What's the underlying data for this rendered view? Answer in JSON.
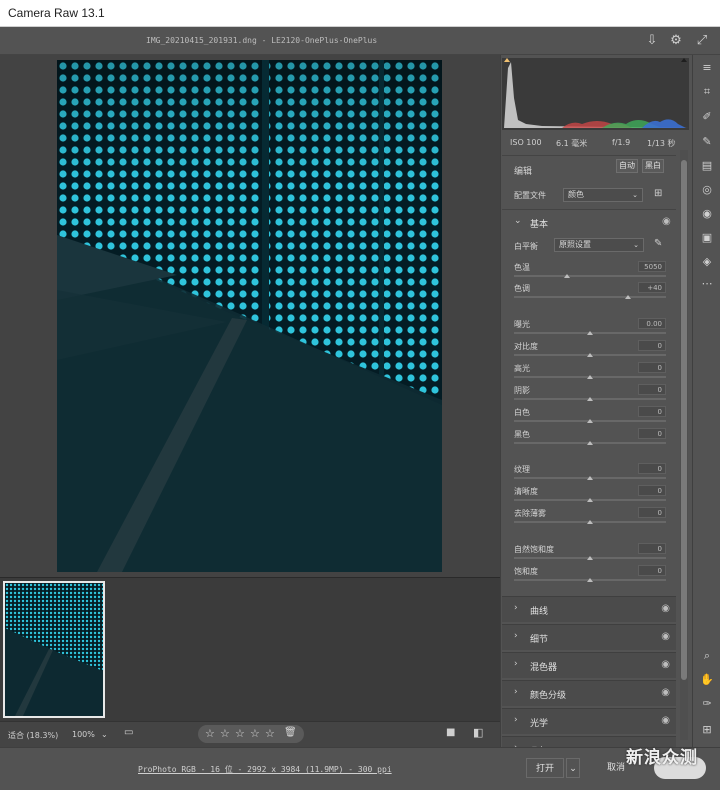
{
  "window": {
    "title": "Camera Raw 13.1"
  },
  "file": {
    "name": "IMG_20210415_201931.dng -  LE2120-OnePlus-OnePlus"
  },
  "exif": {
    "iso": "ISO 100",
    "focal": "6.1 毫米",
    "aperture": "f/1.9",
    "shutter": "1/13 秒"
  },
  "edit": {
    "title": "编辑",
    "auto_label": "自动",
    "bw_label": "黑白"
  },
  "profile": {
    "label": "配置文件",
    "value": "颜色"
  },
  "basic": {
    "title": "基本",
    "white_balance": {
      "label": "白平衡",
      "value": "原照设置"
    },
    "temperature": {
      "label": "色温",
      "value": "5050"
    },
    "tint": {
      "label": "色调",
      "value": "+40"
    },
    "exposure": {
      "label": "曝光",
      "value": "0.00"
    },
    "contrast": {
      "label": "对比度",
      "value": "0"
    },
    "highlights": {
      "label": "高光",
      "value": "0"
    },
    "shadows": {
      "label": "阴影",
      "value": "0"
    },
    "whites": {
      "label": "白色",
      "value": "0"
    },
    "blacks": {
      "label": "黑色",
      "value": "0"
    },
    "texture": {
      "label": "纹理",
      "value": "0"
    },
    "clarity": {
      "label": "清晰度",
      "value": "0"
    },
    "dehaze": {
      "label": "去除薄雾",
      "value": "0"
    },
    "vibrance": {
      "label": "自然饱和度",
      "value": "0"
    },
    "saturation": {
      "label": "饱和度",
      "value": "0"
    }
  },
  "sections": {
    "curve": "曲线",
    "detail": "细节",
    "mixer": "混色器",
    "grading": "颜色分级",
    "optics": "光学",
    "geometry": "几何"
  },
  "bottom": {
    "fit": "适合 (18.3%)",
    "zoom": "100%"
  },
  "footer": {
    "info": "ProPhoto RGB - 16 位 - 2992 x 3984 (11.9MP) - 300 ppi",
    "open": "打开",
    "cancel": "取消"
  },
  "watermark": "新浪众测",
  "colors": {
    "accent_cyan": "#2fc4dc",
    "panel_bg": "#535353"
  }
}
